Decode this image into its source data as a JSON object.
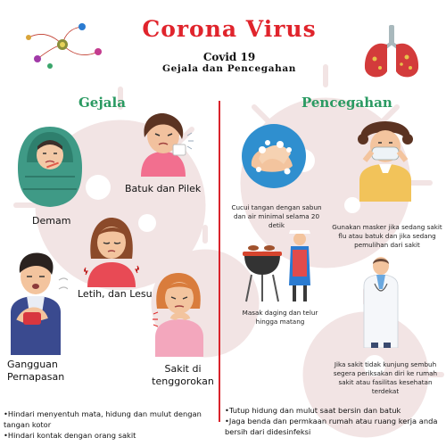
{
  "title": "Corona Virus",
  "subtitle": "Covid 19",
  "tagline": "Gejala dan Pencegahan",
  "colors": {
    "title": "#e0242c",
    "section_heading": "#2a9a62",
    "divider": "#d9232c",
    "background_virus": "#f3e6e6"
  },
  "icons": [
    "virus-particles-icon",
    "lungs-icon"
  ],
  "gejala": {
    "heading": "Gejala",
    "symptoms": [
      {
        "label": "Demam",
        "icon": "fever-person-icon"
      },
      {
        "label": "Batuk dan Pilek",
        "icon": "coughing-person-icon"
      },
      {
        "label": "Letih, dan Lesu",
        "icon": "tired-person-icon"
      },
      {
        "label": "Gangguan Pernapasan",
        "icon": "breathing-difficulty-person-icon"
      },
      {
        "label": "Sakit di tenggorokan",
        "icon": "sore-throat-person-icon"
      }
    ],
    "bullets": [
      "Hindari menyentuh mata, hidung dan mulut dengan tangan kotor",
      "Hindari kontak dengan orang sakit"
    ]
  },
  "pencegahan": {
    "heading": "Pencegahan",
    "tips": [
      {
        "label": "Cucui tangan dengan sabun dan air minimal selama 20 detik",
        "icon": "hand-washing-icon"
      },
      {
        "label": "Gunakan masker jika sedang sakit flu atau batuk dan jika sedang pemulihan dari sakit",
        "icon": "mask-girl-icon"
      },
      {
        "label": "Masak daging dan telur hingga matang",
        "icon": "grill-cooking-icon"
      },
      {
        "label": "Jika sakit tidak kunjung sembuh segera periksakan diri ke rumah sakit atau fasilitas kesehatan terdekat",
        "icon": "doctor-icon"
      }
    ],
    "bullets": [
      "Tutup hidung dan mulut saat bersin dan batuk",
      "Jaga benda dan permkaan rumah atau ruang kerja anda bersih dari didesinfeksi"
    ]
  }
}
